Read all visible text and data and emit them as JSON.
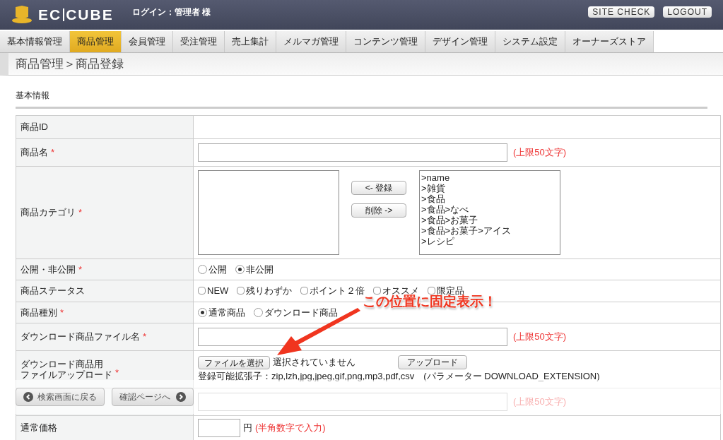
{
  "header": {
    "logo": [
      "EC",
      "CUBE"
    ],
    "login": "ログイン：管理者 様",
    "buttons": [
      "SITE CHECK",
      "LOGOUT"
    ]
  },
  "nav": [
    {
      "label": "基本情報管理",
      "selected": false
    },
    {
      "label": "商品管理",
      "selected": true
    },
    {
      "label": "会員管理",
      "selected": false
    },
    {
      "label": "受注管理",
      "selected": false
    },
    {
      "label": "売上集計",
      "selected": false
    },
    {
      "label": "メルマガ管理",
      "selected": false
    },
    {
      "label": "コンテンツ管理",
      "selected": false
    },
    {
      "label": "デザイン管理",
      "selected": false
    },
    {
      "label": "システム設定",
      "selected": false
    },
    {
      "label": "オーナーズストア",
      "selected": false
    }
  ],
  "breadcrumb": "商品管理＞商品登録",
  "section_title": "基本情報",
  "required_mark": "*",
  "rows": [
    {
      "label": "商品ID",
      "required": false,
      "kind": "empty"
    },
    {
      "label": "商品名",
      "required": true,
      "kind": "text",
      "note": "(上限50文字)"
    },
    {
      "label": "商品カテゴリ",
      "required": true,
      "kind": "category",
      "add_button": "<- 登録",
      "remove_button": "削除 ->",
      "options": [
        ">name",
        ">雑貨",
        ">食品",
        ">食品>なべ",
        ">食品>お菓子",
        ">食品>お菓子>アイス",
        ">レシピ"
      ]
    },
    {
      "label": "公開・非公開",
      "required": true,
      "kind": "radio",
      "options": [
        {
          "label": "公開",
          "selected": false
        },
        {
          "label": "非公開",
          "selected": true
        }
      ]
    },
    {
      "label": "商品ステータス",
      "required": false,
      "kind": "checkbox",
      "options": [
        {
          "label": "NEW",
          "checked": false
        },
        {
          "label": "残りわずか",
          "checked": false
        },
        {
          "label": "ポイント２倍",
          "checked": false
        },
        {
          "label": "オススメ",
          "checked": false
        },
        {
          "label": "限定品",
          "checked": false
        }
      ]
    },
    {
      "label": "商品種別",
      "required": true,
      "kind": "radio",
      "options": [
        {
          "label": "通常商品",
          "selected": true
        },
        {
          "label": "ダウンロード商品",
          "selected": false
        }
      ]
    },
    {
      "label": "ダウンロード商品ファイル名",
      "required": true,
      "kind": "text",
      "note": "(上限50文字)"
    },
    {
      "label_lines": [
        "ダウンロード商品用",
        "ファイルアップロード"
      ],
      "required": true,
      "kind": "file",
      "choose_button": "ファイルを選択",
      "file_status": "選択されていません",
      "upload_button": "アップロード",
      "extensions": "登録可能拡張子：zip,lzh,jpg,jpeg,gif,png,mp3,pdf,csv　(パラメーター DOWNLOAD_EXTENSION)"
    },
    {
      "kind": "text",
      "note": "(上限50文字)"
    },
    {
      "label": "通常価格",
      "required": false,
      "kind": "price",
      "unit": "円",
      "note": "(半角数字で入力)"
    }
  ],
  "fixed_bar": {
    "back_button": "検索画面に戻る",
    "confirm_button": "確認ページへ"
  },
  "annotation": {
    "callout": "この位置に固定表示！"
  }
}
